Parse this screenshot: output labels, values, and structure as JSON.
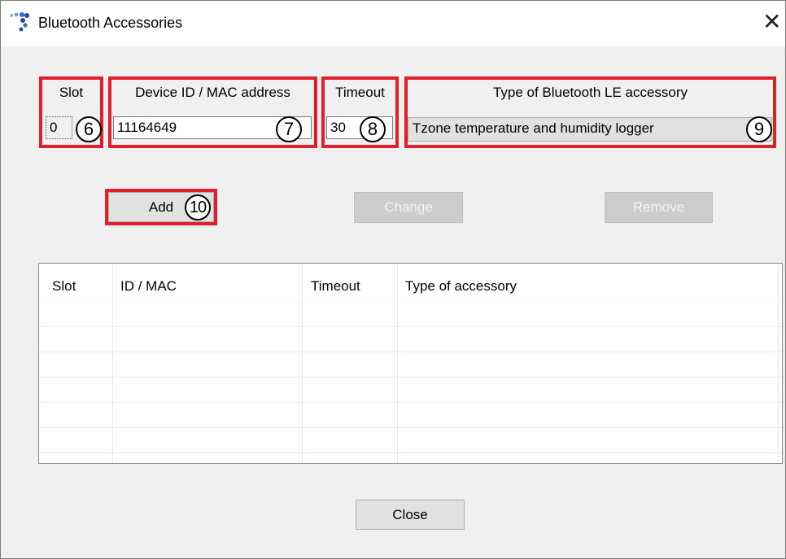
{
  "window": {
    "title": "Bluetooth Accessories",
    "close_glyph": "✕",
    "app_icon": "bluetooth-dots-icon"
  },
  "form": {
    "slot": {
      "label": "Slot",
      "value": "0"
    },
    "device_id": {
      "label": "Device ID / MAC address",
      "value": "11164649"
    },
    "timeout": {
      "label": "Timeout",
      "value": "30"
    },
    "type": {
      "label": "Type of Bluetooth LE accessory",
      "value": "Tzone temperature and humidity logger"
    }
  },
  "callouts": {
    "slot": "6",
    "device_id": "7",
    "timeout": "8",
    "type": "9",
    "add": "10"
  },
  "buttons": {
    "add": "Add",
    "change": "Change",
    "remove": "Remove",
    "close": "Close"
  },
  "table": {
    "columns": [
      "Slot",
      "ID / MAC",
      "Timeout",
      "Type of accessory"
    ],
    "rows": []
  },
  "colors": {
    "highlight": "#e31e2b",
    "window_bg": "#f0f0f0",
    "titlebar_bg": "#ffffff"
  }
}
